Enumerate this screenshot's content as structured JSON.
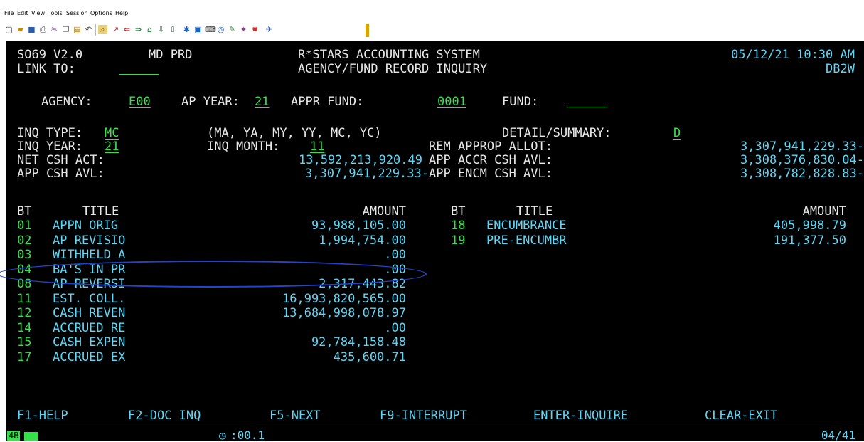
{
  "menu": [
    "File",
    "Edit",
    "View",
    "Tools",
    "Session",
    "Options",
    "Help"
  ],
  "toolbar_icons": [
    "new-icon",
    "open-icon",
    "save-icon",
    "print-icon",
    "cut-icon",
    "copy-icon",
    "paste-icon",
    "undo-icon",
    "find-icon",
    "macro-icon",
    "back-icon",
    "forward-icon",
    "home-icon",
    "receive-icon",
    "send-icon",
    "config-icon",
    "display-icon",
    "keyboard-icon",
    "color-icon",
    "edit-icon",
    "hotspot-icon",
    "help-icon"
  ],
  "header": {
    "screen_id": "SO69 V2.0",
    "region": "MD PRD",
    "system_title": "R*STARS ACCOUNTING SYSTEM",
    "datetime": "05/12/21 10:30 AM",
    "link_label": "LINK TO:",
    "screen_title": "AGENCY/FUND RECORD INQUIRY",
    "terminal_id": "DB2W"
  },
  "keys": {
    "agency_label": "AGENCY:",
    "agency_value": "E00",
    "ap_year_label": "AP YEAR:",
    "ap_year_value": "21",
    "appr_fund_label": "APPR FUND:",
    "appr_fund_value": "0001",
    "fund_label": "FUND:"
  },
  "inquiry": {
    "inq_type_label": "INQ TYPE:",
    "inq_type_value": "MC",
    "options_hint": "(MA, YA, MY, YY, MC, YC)",
    "detail_label": "DETAIL/SUMMARY:",
    "detail_value": "D",
    "inq_year_label": "INQ YEAR:",
    "inq_year_value": "21",
    "inq_month_label": "INQ MONTH:",
    "inq_month_value": "11",
    "rem_approp_label": "REM APPROP ALLOT:",
    "rem_approp_value": "3,307,941,229.33-",
    "net_csh_label": "NET CSH ACT:",
    "net_csh_value": "13,592,213,920.49",
    "app_accr_label": "APP ACCR CSH AVL:",
    "app_accr_value": "3,308,376,830.04-",
    "app_csh_label": "APP CSH AVL:",
    "app_csh_value": "3,307,941,229.33-",
    "app_encm_label": "APP ENCM CSH AVL:",
    "app_encm_value": "3,308,782,828.83-"
  },
  "table": {
    "col_bt": "BT",
    "col_title": "TITLE",
    "col_amount": "AMOUNT",
    "left_rows": [
      {
        "bt": "01",
        "title": "APPN ORIG",
        "amount": "93,988,105.00"
      },
      {
        "bt": "02",
        "title": "AP REVISIO",
        "amount": "1,994,754.00"
      },
      {
        "bt": "03",
        "title": "WITHHELD A",
        "amount": ".00"
      },
      {
        "bt": "04",
        "title": "BA'S IN PR",
        "amount": ".00"
      },
      {
        "bt": "08",
        "title": "AP REVERSI",
        "amount": "2,317,443.82"
      },
      {
        "bt": "11",
        "title": "EST. COLL.",
        "amount": "16,993,820,565.00"
      },
      {
        "bt": "12",
        "title": "CASH REVEN",
        "amount": "13,684,998,078.97"
      },
      {
        "bt": "14",
        "title": "ACCRUED RE",
        "amount": ".00"
      },
      {
        "bt": "15",
        "title": "CASH EXPEN",
        "amount": "92,784,158.48"
      },
      {
        "bt": "17",
        "title": "ACCRUED EX",
        "amount": "435,600.71"
      }
    ],
    "right_rows": [
      {
        "bt": "18",
        "title": "ENCUMBRANCE",
        "amount": "405,998.79"
      },
      {
        "bt": "19",
        "title": "PRE-ENCUMBR",
        "amount": "191,377.50"
      }
    ]
  },
  "function_keys": [
    "F1-HELP",
    "F2-DOC INQ",
    "F5-NEXT",
    "F9-INTERRUPT",
    "ENTER-INQUIRE",
    "CLEAR-EXIT"
  ],
  "status": {
    "session_tag": "4B",
    "timer": ":00.1",
    "cursor_pos": "04/41"
  },
  "colors": {
    "screen_bg": "#000000",
    "label": "#e8e8e8",
    "value": "#5fd6f5",
    "input": "#36e04a",
    "annotation": "#2244cc"
  }
}
